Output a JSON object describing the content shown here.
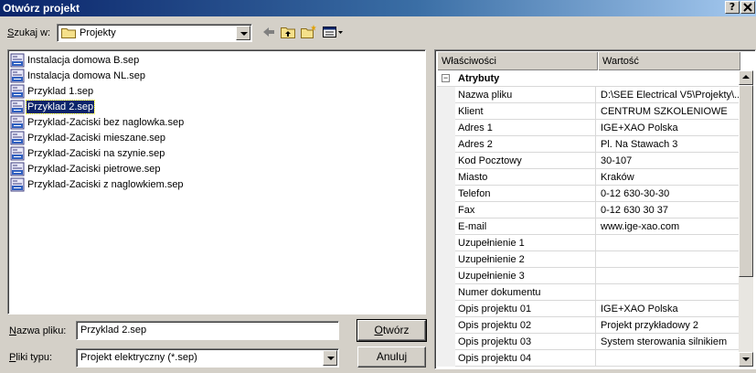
{
  "window": {
    "title": "Otwórz projekt",
    "help_button": "?",
    "close_button": "X"
  },
  "location": {
    "label": "Szukaj w:",
    "value": "Projekty"
  },
  "files": [
    {
      "name": "Instalacja domowa B.sep",
      "selected": false
    },
    {
      "name": "Instalacja domowa NL.sep",
      "selected": false
    },
    {
      "name": "Przyklad 1.sep",
      "selected": false
    },
    {
      "name": "Przyklad 2.sep",
      "selected": true
    },
    {
      "name": "Przyklad-Zaciski bez naglowka.sep",
      "selected": false
    },
    {
      "name": "Przyklad-Zaciski mieszane.sep",
      "selected": false
    },
    {
      "name": "Przyklad-Zaciski na szynie.sep",
      "selected": false
    },
    {
      "name": "Przyklad-Zaciski pietrowe.sep",
      "selected": false
    },
    {
      "name": "Przyklad-Zaciski z naglowkiem.sep",
      "selected": false
    }
  ],
  "filename": {
    "label": "Nazwa pliku:",
    "value": "Przyklad 2.sep"
  },
  "filetype": {
    "label": "Pliki typu:",
    "value": "Projekt elektryczny (*.sep)"
  },
  "buttons": {
    "open": "Otwórz",
    "cancel": "Anuluj"
  },
  "properties": {
    "col_name": "Właściwości",
    "col_value": "Wartość",
    "group": "Atrybuty",
    "rows": [
      {
        "name": "Nazwa pliku",
        "value": "D:\\SEE Electrical V5\\Projekty\\..."
      },
      {
        "name": "Klient",
        "value": "CENTRUM SZKOLENIOWE"
      },
      {
        "name": "Adres 1",
        "value": "IGE+XAO Polska"
      },
      {
        "name": "Adres 2",
        "value": "Pl. Na Stawach 3"
      },
      {
        "name": "Kod Pocztowy",
        "value": "30-107"
      },
      {
        "name": "Miasto",
        "value": "Kraków"
      },
      {
        "name": "Telefon",
        "value": "0-12 630-30-30"
      },
      {
        "name": "Fax",
        "value": "0-12 630 30 37"
      },
      {
        "name": "E-mail",
        "value": "www.ige-xao.com"
      },
      {
        "name": "Uzupełnienie 1",
        "value": ""
      },
      {
        "name": "Uzupełnienie 2",
        "value": ""
      },
      {
        "name": "Uzupełnienie 3",
        "value": ""
      },
      {
        "name": "Numer dokumentu",
        "value": ""
      },
      {
        "name": "Opis projektu 01",
        "value": "IGE+XAO Polska"
      },
      {
        "name": "Opis projektu 02",
        "value": "Projekt przykładowy 2"
      },
      {
        "name": "Opis projektu 03",
        "value": "System sterowania silnikiem"
      },
      {
        "name": "Opis projektu 04",
        "value": ""
      }
    ]
  },
  "colors": {
    "title_start": "#0a246a",
    "title_end": "#a6caf0",
    "face": "#d4d0c8",
    "selection": "#0a246a"
  }
}
